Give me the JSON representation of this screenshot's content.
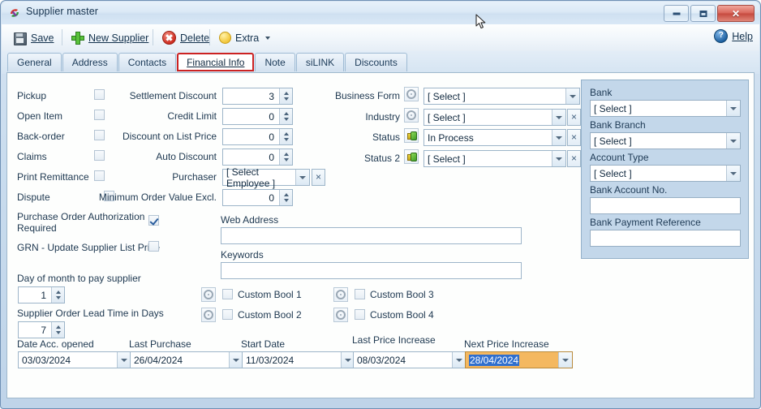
{
  "window": {
    "title": "Supplier master",
    "app_icon": "supplier-app-icon",
    "minimize_label": "Minimize",
    "maximize_label": "Maximize",
    "close_label": "Close"
  },
  "toolbar": {
    "save_label": "Save",
    "new_supplier_label": "New Supplier",
    "delete_label": "Delete",
    "extra_label": "Extra",
    "help_label": "Help",
    "help_glyph": "?"
  },
  "tabs": [
    {
      "label": "General",
      "active": false
    },
    {
      "label": "Address",
      "active": false
    },
    {
      "label": "Contacts",
      "active": false
    },
    {
      "label": "Financial Info",
      "active": true
    },
    {
      "label": "Note",
      "active": false
    },
    {
      "label": "siLINK",
      "active": false
    },
    {
      "label": "Discounts",
      "active": false
    }
  ],
  "checkboxes_left": [
    {
      "label": "Pickup",
      "checked": false
    },
    {
      "label": "Open Item",
      "checked": false
    },
    {
      "label": "Back-order",
      "checked": false
    },
    {
      "label": "Claims",
      "checked": false
    },
    {
      "label": "Print Remittance",
      "checked": false
    },
    {
      "label": "Dispute",
      "checked": false
    }
  ],
  "numeric_fields": [
    {
      "label": "Settlement Discount",
      "value": "3"
    },
    {
      "label": "Credit Limit",
      "value": "0"
    },
    {
      "label": "Discount on List Price",
      "value": "0"
    },
    {
      "label": "Auto Discount",
      "value": "0"
    },
    {
      "label": "Minimum Order Value Excl.",
      "value": "0"
    }
  ],
  "purchaser": {
    "label": "Purchaser",
    "value": "[ Select Employee ]",
    "clear_label": "×"
  },
  "selects_right": [
    {
      "label": "Business Form",
      "value": "[ Select ]",
      "icon": "gear-icon",
      "has_clear": false
    },
    {
      "label": "Industry",
      "value": "[ Select ]",
      "icon": "gear-icon",
      "has_clear": true
    },
    {
      "label": "Status",
      "value": "In Process",
      "icon": "status-icon",
      "has_clear": true
    },
    {
      "label": "Status 2",
      "value": "[ Select ]",
      "icon": "status-icon",
      "has_clear": true
    }
  ],
  "po_auth": {
    "label_line1": "Purchase Order Authorization",
    "label_line2": "Required",
    "checked": true
  },
  "grn": {
    "label": "GRN - Update Supplier List Price",
    "checked": false
  },
  "web_address": {
    "label": "Web Address",
    "value": ""
  },
  "keywords": {
    "label": "Keywords",
    "value": ""
  },
  "day_of_month": {
    "label": "Day of month to pay supplier",
    "value": "1"
  },
  "lead_time": {
    "label": "Supplier Order Lead Time in Days",
    "value": "7"
  },
  "custom_bools": [
    {
      "label": "Custom Bool 1",
      "checked": false,
      "icon": "gear-icon"
    },
    {
      "label": "Custom Bool 2",
      "checked": false,
      "icon": "gear-icon"
    },
    {
      "label": "Custom Bool 3",
      "checked": false,
      "icon": "gear-icon"
    },
    {
      "label": "Custom Bool 4",
      "checked": false,
      "icon": "gear-icon"
    }
  ],
  "dates": [
    {
      "label": "Date Acc. opened",
      "value": "03/03/2024",
      "highlighted": false
    },
    {
      "label": "Last Purchase",
      "value": "26/04/2024",
      "highlighted": false
    },
    {
      "label": "Start Date",
      "value": "11/03/2024",
      "highlighted": false
    },
    {
      "label": "Last Price Increase",
      "value": "08/03/2024",
      "highlighted": false
    },
    {
      "label": "Next Price Increase",
      "value": "28/04/2024",
      "highlighted": true
    }
  ],
  "bank_panel": {
    "fields": [
      {
        "label": "Bank",
        "value": "[ Select ]",
        "type": "select"
      },
      {
        "label": "Bank Branch",
        "value": "[ Select ]",
        "type": "select"
      },
      {
        "label": "Account Type",
        "value": "[ Select ]",
        "type": "select"
      },
      {
        "label": "Bank Account No.",
        "value": "",
        "type": "text"
      },
      {
        "label": "Bank Payment Reference",
        "value": "",
        "type": "text"
      }
    ]
  },
  "colors": {
    "accent_red": "#cc2222",
    "highlight_amber": "#f4b860",
    "selection_blue": "#2f6fce",
    "panel_blue": "#c3d7ea",
    "window_chrome": "#cfe0f1"
  }
}
